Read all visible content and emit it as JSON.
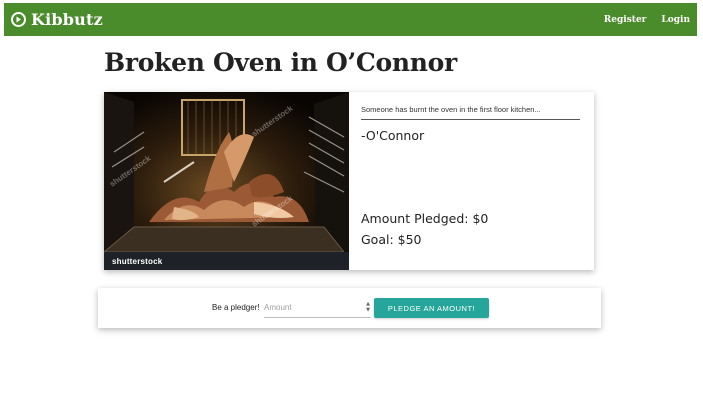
{
  "header": {
    "brand_name": "Kibbutz",
    "brand_icon": "play-circle-icon",
    "register_label": "Register",
    "login_label": "Login",
    "bar_color": "#4a8b2b"
  },
  "project": {
    "title": "Broken Oven in O’Connor",
    "image_watermark": "shutterstock",
    "description": "Someone has burnt the oven in the first floor kitchen...",
    "author": "-O'Connor",
    "amount_pledged": "Amount Pledged: $0",
    "goal": "Goal: $50"
  },
  "pledge": {
    "label": "Be a pledger!",
    "amount_placeholder": "Amount",
    "button_label": "PLEDGE AN AMOUNT!",
    "button_color": "#26a69a"
  }
}
